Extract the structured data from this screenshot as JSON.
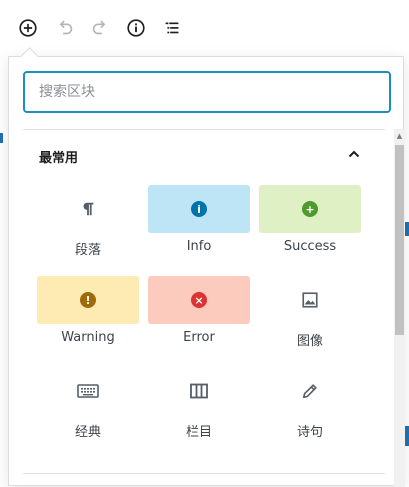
{
  "toolbar": {
    "items": [
      {
        "icon": "add-block-icon"
      },
      {
        "icon": "undo-icon"
      },
      {
        "icon": "redo-icon"
      },
      {
        "icon": "info-icon"
      },
      {
        "icon": "list-view-icon"
      }
    ]
  },
  "inserter": {
    "search": {
      "placeholder": "搜索区块",
      "value": ""
    },
    "section": {
      "title": "最常用",
      "expanded": true
    },
    "blocks": [
      {
        "label": "段落",
        "icon": "paragraph-icon",
        "color": "#ffffff"
      },
      {
        "label": "Info",
        "icon": "info-circle-icon",
        "color": "#bee5f5"
      },
      {
        "label": "Success",
        "icon": "plus-circle-icon",
        "color": "#e0f0c5"
      },
      {
        "label": "Warning",
        "icon": "exclamation-circle-icon",
        "color": "#fdebb3"
      },
      {
        "label": "Error",
        "icon": "x-circle-icon",
        "color": "#fdcbbd"
      },
      {
        "label": "图像",
        "icon": "image-icon",
        "color": "#ffffff"
      },
      {
        "label": "经典",
        "icon": "keyboard-icon",
        "color": "#ffffff"
      },
      {
        "label": "栏目",
        "icon": "columns-icon",
        "color": "#ffffff"
      },
      {
        "label": "诗句",
        "icon": "pencil-icon",
        "color": "#ffffff"
      }
    ]
  },
  "colors": {
    "accent": "#1e8cbe",
    "info": "#0073aa",
    "success": "#4f9a2c",
    "warning": "#a0690a",
    "error": "#dc3232"
  }
}
